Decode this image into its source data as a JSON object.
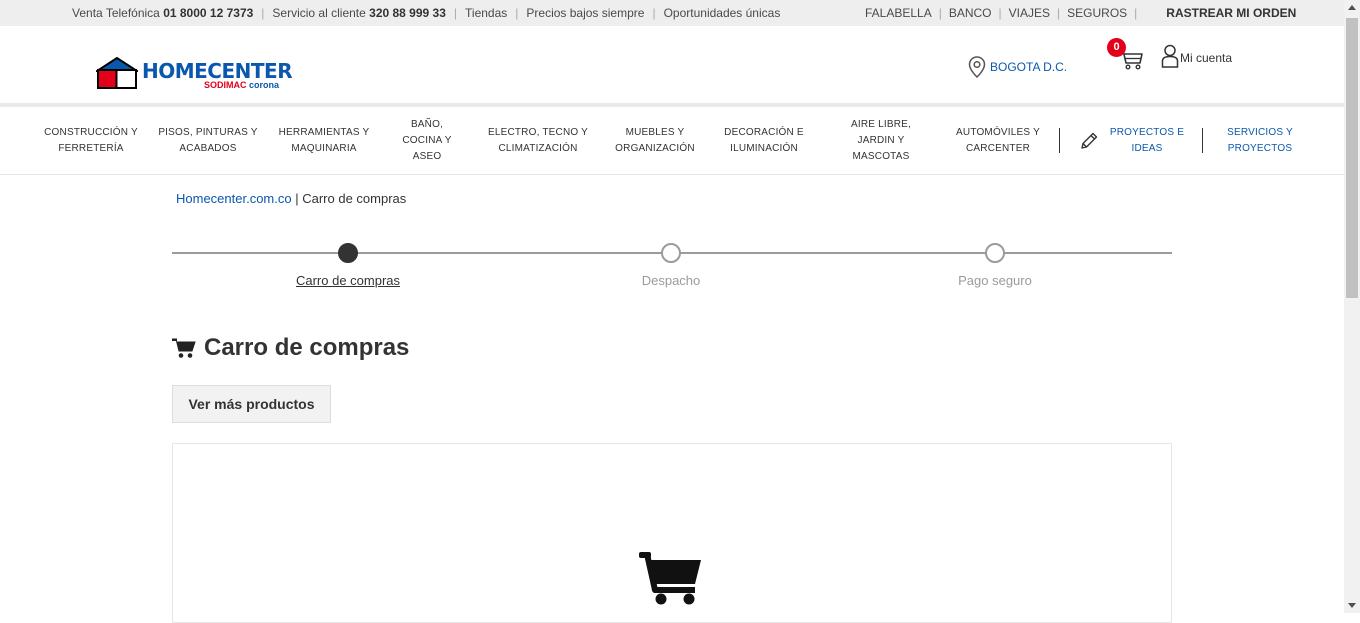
{
  "topbar": {
    "venta_label": "Venta Telefónica",
    "venta_phone": "01 8000 12 7373",
    "servicio_label": "Servicio al cliente",
    "servicio_phone": "320 88 999 33",
    "tiendas": "Tiendas",
    "precios": "Precios bajos siempre",
    "oportunidades": "Oportunidades únicas",
    "falabella": "FALABELLA",
    "banco": "BANCO",
    "viajes": "VIAJES",
    "seguros": "SEGUROS",
    "rastrear": "RASTREAR MI ORDEN"
  },
  "header": {
    "logo_text": "HOMECENTER",
    "logo_sub1": "SODIMAC",
    "logo_sub2": "corona",
    "location": "BOGOTA D.C.",
    "cart_count": "0",
    "account": "Mi cuenta"
  },
  "nav": {
    "items": [
      "CONSTRUCCIÓN Y FERRETERÍA",
      "PISOS, PINTURAS Y ACABADOS",
      "HERRAMIENTAS Y MAQUINARIA",
      "BAÑO, COCINA Y ASEO",
      "ELECTRO, TECNO Y CLIMATIZACIÓN",
      "MUEBLES Y ORGANIZACIÓN",
      "DECORACIÓN E ILUMINACIÓN",
      "AIRE LIBRE, JARDIN Y MASCOTAS",
      "AUTOMÓVILES Y CARCENTER"
    ],
    "proyectos": "PROYECTOS E IDEAS",
    "servicios": "SERVICIOS Y PROYECTOS"
  },
  "breadcrumb": {
    "home": "Homecenter.com.co",
    "separator": " | ",
    "current": "Carro de compras"
  },
  "steps": [
    {
      "label": "Carro de compras",
      "active": true
    },
    {
      "label": "Despacho",
      "active": false
    },
    {
      "label": "Pago seguro",
      "active": false
    }
  ],
  "main": {
    "title": "Carro de compras",
    "more_button": "Ver más productos"
  },
  "colors": {
    "brand_blue": "#0a58ad",
    "brand_red": "#e2001a",
    "topbar_bg": "#eeeeee"
  }
}
